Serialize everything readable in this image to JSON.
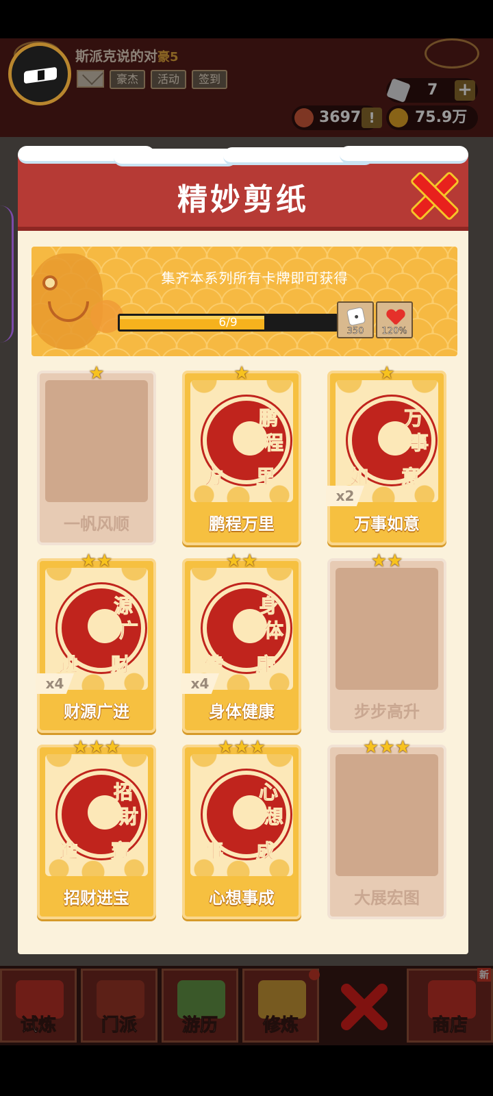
{
  "player": {
    "name": "斯派克说的对",
    "rank": "豪5",
    "buttons": [
      "豪杰",
      "活动",
      "签到"
    ]
  },
  "resources": {
    "gems": "7",
    "tokens": "3697",
    "coins": "75.9万"
  },
  "popup": {
    "title": "精妙剪纸",
    "banner_text": "集齐本系列所有卡牌即可获得",
    "progress_text": "6/9",
    "progress_fraction": 0.667,
    "rewards": [
      {
        "icon": "dice-icon",
        "value": "350"
      },
      {
        "icon": "heart-icon",
        "value": "120%"
      }
    ],
    "cards": [
      {
        "name": "一帆风顺",
        "stars": 1,
        "owned": false,
        "count": ""
      },
      {
        "name": "鹏程万里",
        "stars": 1,
        "owned": true,
        "count": "",
        "art": [
          "鹏",
          "程",
          "方",
          "里"
        ]
      },
      {
        "name": "万事如意",
        "stars": 1,
        "owned": true,
        "count": "x2",
        "art": [
          "万",
          "事",
          "如",
          "意"
        ]
      },
      {
        "name": "财源广进",
        "stars": 2,
        "owned": true,
        "count": "x4",
        "art": [
          "源",
          "广",
          "进",
          "财"
        ]
      },
      {
        "name": "身体健康",
        "stars": 2,
        "owned": true,
        "count": "x4",
        "art": [
          "身",
          "体",
          "健",
          "康"
        ]
      },
      {
        "name": "步步高升",
        "stars": 2,
        "owned": false,
        "count": ""
      },
      {
        "name": "招财进宝",
        "stars": 3,
        "owned": true,
        "count": "",
        "art": [
          "招",
          "財",
          "進",
          "寶"
        ]
      },
      {
        "name": "心想事成",
        "stars": 3,
        "owned": true,
        "count": "",
        "art": [
          "心",
          "想",
          "事",
          "成"
        ]
      },
      {
        "name": "大展宏图",
        "stars": 3,
        "owned": false,
        "count": ""
      }
    ]
  },
  "bottom_nav": [
    "试炼",
    "门派",
    "游历",
    "修炼",
    "商店"
  ],
  "bottom_nav_badge": "新",
  "colors": {
    "header_red": "#b63a35",
    "card_gold": "#f6c040",
    "card_locked": "#e7cbb4",
    "close_red": "#e8211d"
  }
}
